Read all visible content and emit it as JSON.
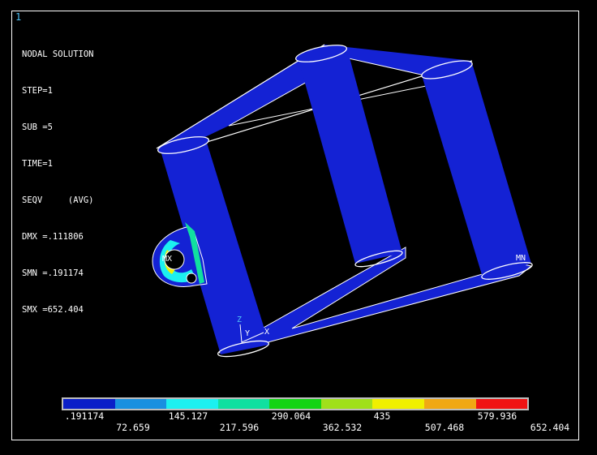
{
  "window": {
    "number": "1"
  },
  "info": {
    "title": "NODAL SOLUTION",
    "lines": [
      "STEP=1",
      "SUB =5",
      "TIME=1",
      "SEQV     (AVG)",
      "DMX =.111806",
      "SMN =.191174",
      "SMX =652.404"
    ]
  },
  "markers": {
    "max": "MX",
    "min": "MN",
    "triad_z": "Z",
    "triad_y": "Y",
    "triad_x": "X"
  },
  "legend": {
    "colors": [
      "#0a1ec8",
      "#1890e0",
      "#1cf0f0",
      "#10e0a0",
      "#14d414",
      "#a0e01a",
      "#f0f000",
      "#f0a814",
      "#f01414"
    ],
    "labels_top": [
      ".191174",
      "145.127",
      "290.064",
      "435",
      "579.936"
    ],
    "labels_bottom": [
      "72.659",
      "217.596",
      "362.532",
      "507.468",
      "652.404"
    ]
  },
  "colors": {
    "model_blue": "#1422d4",
    "background": "#000000",
    "edge_white": "#ffffff"
  }
}
